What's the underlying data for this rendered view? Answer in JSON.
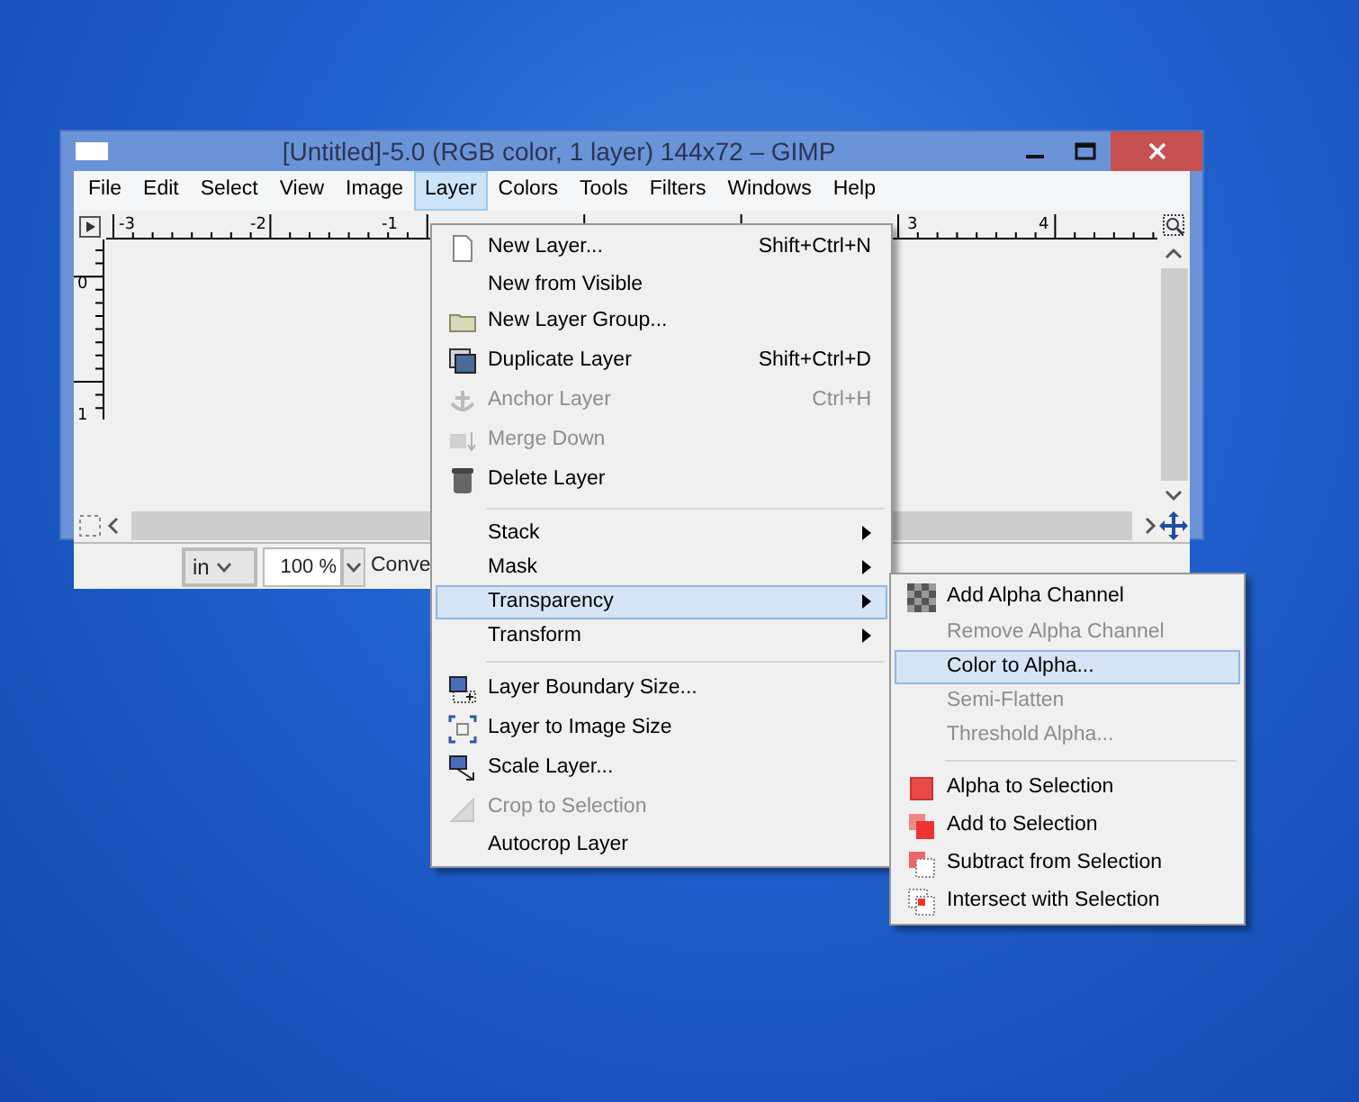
{
  "window": {
    "title": "[Untitled]-5.0 (RGB color, 1 layer) 144x72 – GIMP"
  },
  "menubar": [
    {
      "label": "File",
      "selected": false
    },
    {
      "label": "Edit",
      "selected": false
    },
    {
      "label": "Select",
      "selected": false
    },
    {
      "label": "View",
      "selected": false
    },
    {
      "label": "Image",
      "selected": false
    },
    {
      "label": "Layer",
      "selected": true
    },
    {
      "label": "Colors",
      "selected": false
    },
    {
      "label": "Tools",
      "selected": false
    },
    {
      "label": "Filters",
      "selected": false
    },
    {
      "label": "Windows",
      "selected": false
    },
    {
      "label": "Help",
      "selected": false
    }
  ],
  "rulers": {
    "horizontal": [
      "-3",
      "-2",
      "-1",
      "3",
      "4"
    ],
    "vertical": [
      "0",
      "1"
    ]
  },
  "status_bar": {
    "unit": "in",
    "zoom": "100 %",
    "message": "Conve"
  },
  "layer_menu": [
    {
      "kind": "item",
      "label": "New Layer...",
      "shortcut": "Shift+Ctrl+N",
      "disabled": false,
      "selected": false
    },
    {
      "kind": "item",
      "label": "New from Visible",
      "disabled": false,
      "selected": false
    },
    {
      "kind": "item",
      "label": "New Layer Group...",
      "disabled": false,
      "selected": false
    },
    {
      "kind": "item",
      "label": "Duplicate Layer",
      "shortcut": "Shift+Ctrl+D",
      "disabled": false,
      "selected": false
    },
    {
      "kind": "item",
      "label": "Anchor Layer",
      "shortcut": "Ctrl+H",
      "disabled": true,
      "selected": false
    },
    {
      "kind": "item",
      "label": "Merge Down",
      "disabled": true,
      "selected": false
    },
    {
      "kind": "item",
      "label": "Delete Layer",
      "disabled": false,
      "selected": false
    },
    {
      "kind": "separator"
    },
    {
      "kind": "submenu",
      "label": "Stack",
      "disabled": false,
      "selected": false
    },
    {
      "kind": "submenu",
      "label": "Mask",
      "disabled": false,
      "selected": false
    },
    {
      "kind": "submenu",
      "label": "Transparency",
      "disabled": false,
      "selected": true
    },
    {
      "kind": "submenu",
      "label": "Transform",
      "disabled": false,
      "selected": false
    },
    {
      "kind": "separator"
    },
    {
      "kind": "item",
      "label": "Layer Boundary Size...",
      "disabled": false,
      "selected": false
    },
    {
      "kind": "item",
      "label": "Layer to Image Size",
      "disabled": false,
      "selected": false
    },
    {
      "kind": "item",
      "label": "Scale Layer...",
      "disabled": false,
      "selected": false
    },
    {
      "kind": "item",
      "label": "Crop to Selection",
      "disabled": true,
      "selected": false
    },
    {
      "kind": "item",
      "label": "Autocrop Layer",
      "disabled": false,
      "selected": false
    }
  ],
  "transparency_menu": [
    {
      "kind": "item",
      "label": "Add Alpha Channel",
      "disabled": false,
      "selected": false
    },
    {
      "kind": "item",
      "label": "Remove Alpha Channel",
      "disabled": true,
      "selected": false
    },
    {
      "kind": "item",
      "label": "Color to Alpha...",
      "disabled": false,
      "selected": true
    },
    {
      "kind": "item",
      "label": "Semi-Flatten",
      "disabled": true,
      "selected": false
    },
    {
      "kind": "item",
      "label": "Threshold Alpha...",
      "disabled": true,
      "selected": false
    },
    {
      "kind": "separator"
    },
    {
      "kind": "item",
      "label": "Alpha to Selection",
      "disabled": false,
      "selected": false
    },
    {
      "kind": "item",
      "label": "Add to Selection",
      "disabled": false,
      "selected": false
    },
    {
      "kind": "item",
      "label": "Subtract from Selection",
      "disabled": false,
      "selected": false
    },
    {
      "kind": "item",
      "label": "Intersect with Selection",
      "disabled": false,
      "selected": false
    }
  ]
}
